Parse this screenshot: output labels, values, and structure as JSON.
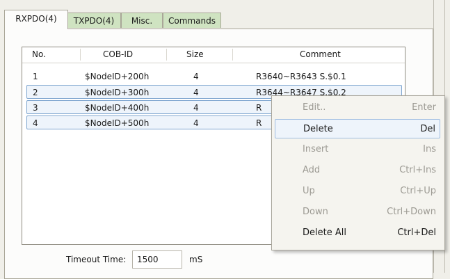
{
  "tabs": [
    {
      "label": "RXPDO(4)",
      "active": true
    },
    {
      "label": "TXPDO(4)",
      "active": false
    },
    {
      "label": "Misc.",
      "active": false
    },
    {
      "label": "Commands",
      "active": false
    }
  ],
  "table": {
    "columns": [
      "No.",
      "COB-ID",
      "Size",
      "Comment"
    ],
    "rows": [
      {
        "no": "1",
        "cob_id": "$NodeID+200h",
        "size": "4",
        "comment": "R3640~R3643 S.$0.1"
      },
      {
        "no": "2",
        "cob_id": "$NodeID+300h",
        "size": "4",
        "comment": "R3644~R3647 S.$0.2"
      },
      {
        "no": "3",
        "cob_id": "$NodeID+400h",
        "size": "4",
        "comment": "R"
      },
      {
        "no": "4",
        "cob_id": "$NodeID+500h",
        "size": "4",
        "comment": "R"
      }
    ]
  },
  "context_menu": {
    "items": [
      {
        "label": "Edit..",
        "shortcut": "Enter",
        "enabled": false
      },
      {
        "label": "Delete",
        "shortcut": "Del",
        "enabled": true
      },
      {
        "label": "Insert",
        "shortcut": "Ins",
        "enabled": false
      },
      {
        "label": "Add",
        "shortcut": "Ctrl+Ins",
        "enabled": false
      },
      {
        "label": "Up",
        "shortcut": "Ctrl+Up",
        "enabled": false
      },
      {
        "label": "Down",
        "shortcut": "Ctrl+Down",
        "enabled": false
      },
      {
        "label": "Delete All",
        "shortcut": "Ctrl+Del",
        "enabled": true
      }
    ]
  },
  "timeout": {
    "label": "Timeout Time:",
    "value": "1500",
    "unit": "mS"
  },
  "colors": {
    "tab_green": "#cfe3c1",
    "selection_border": "#7ea5cf",
    "menu_bg": "#f5f4ef"
  }
}
